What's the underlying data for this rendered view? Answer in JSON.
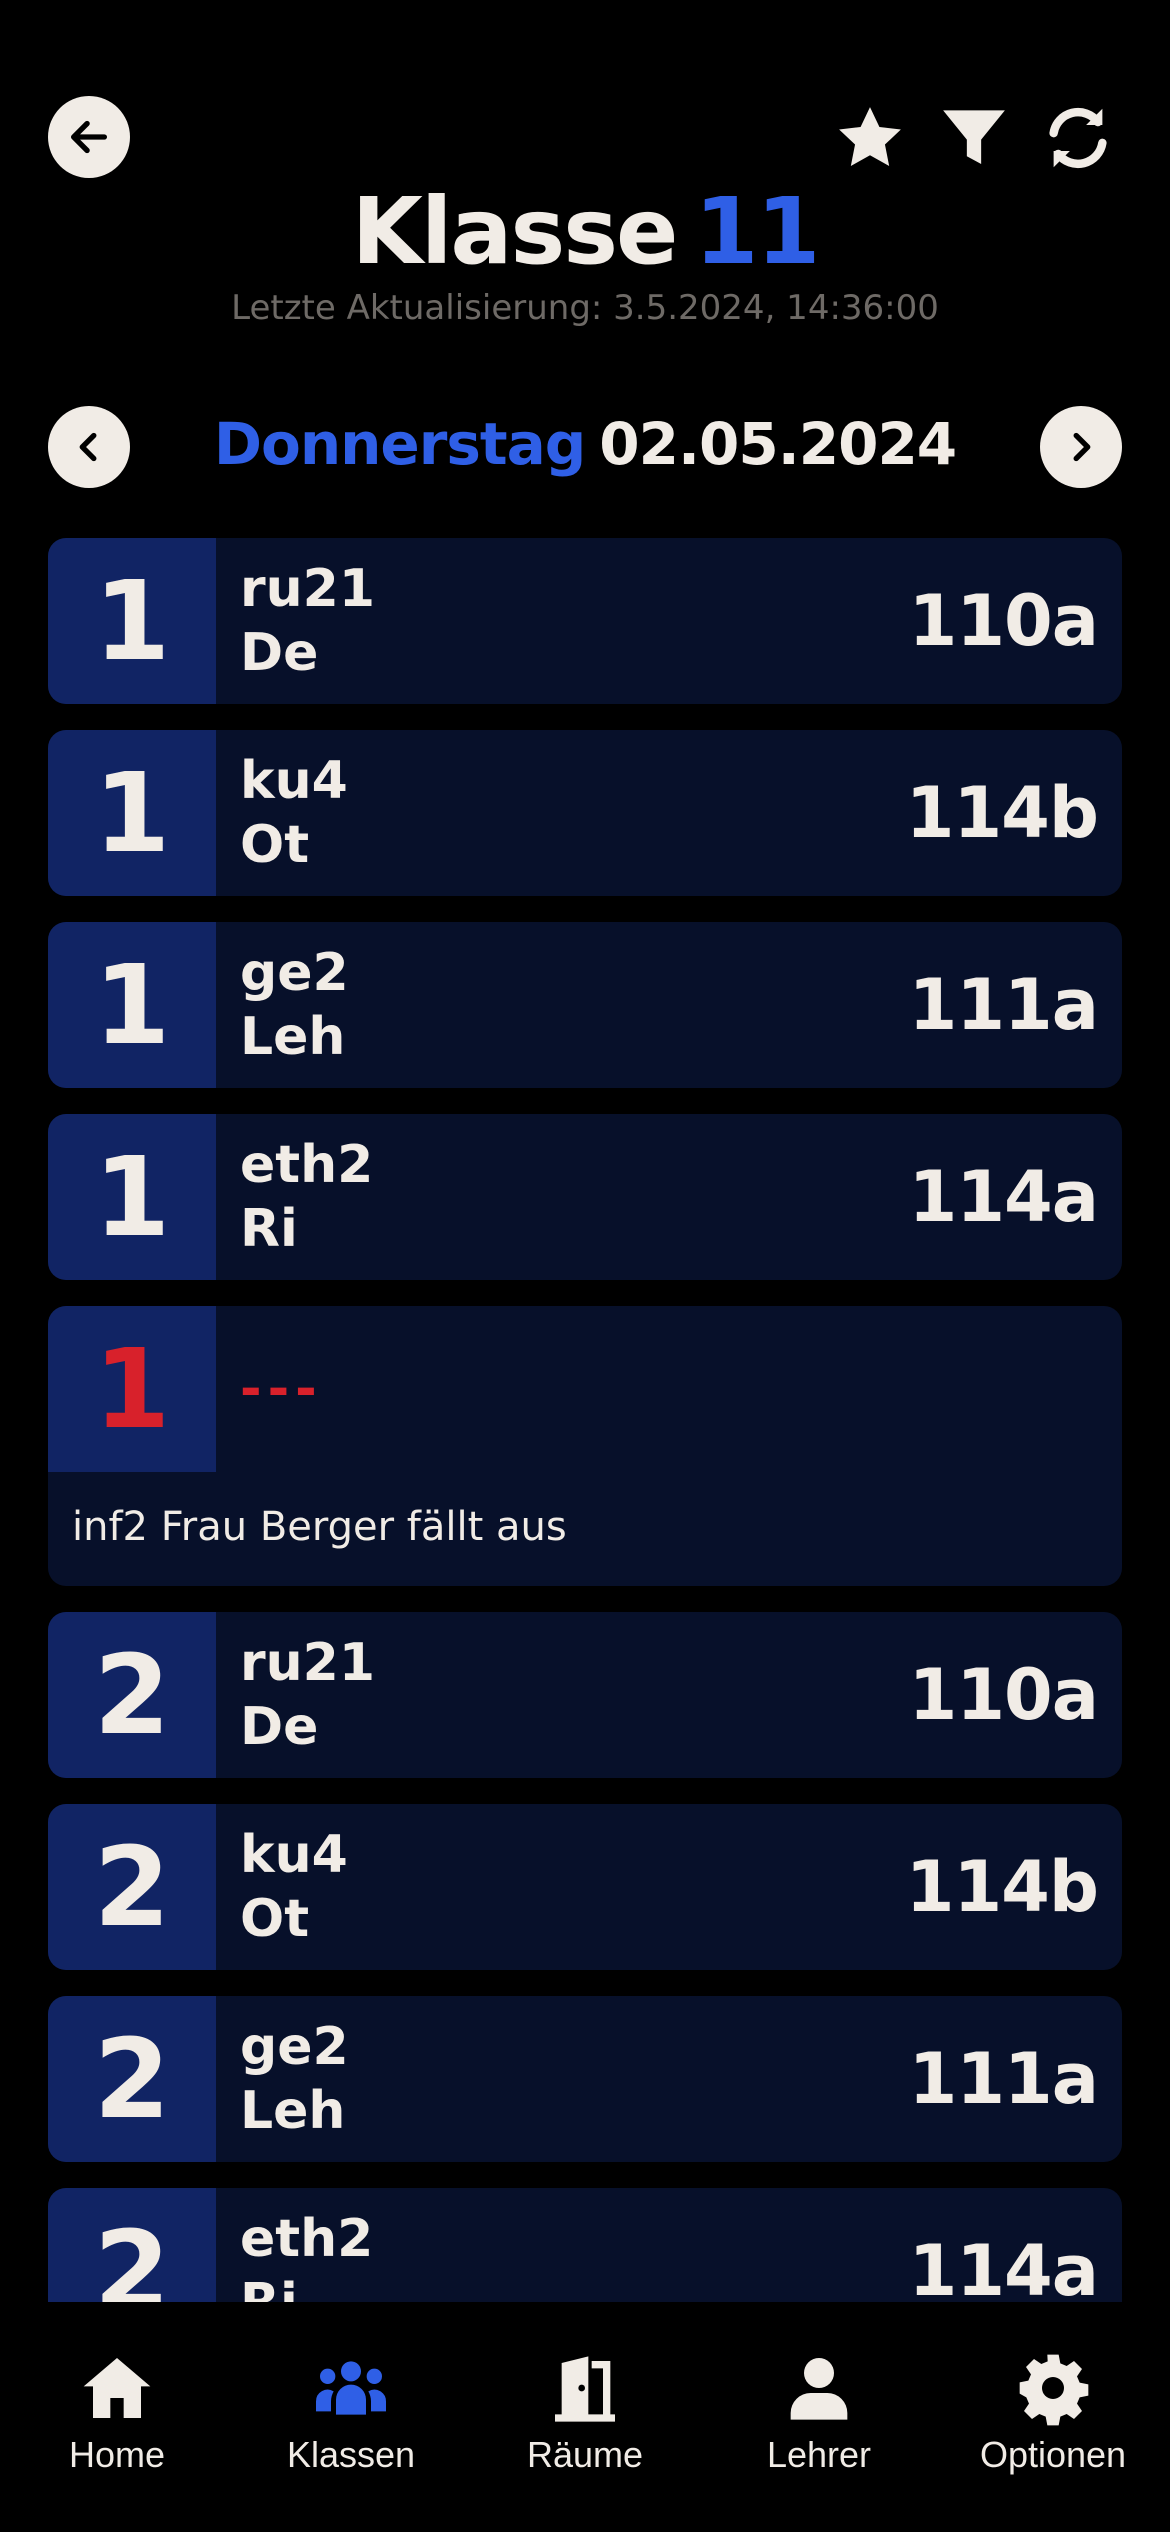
{
  "header": {
    "title": "Klasse",
    "class_number": "11",
    "last_update": "Letzte Aktualisierung: 3.5.2024, 14:36:00"
  },
  "date_nav": {
    "weekday": "Donnerstag",
    "date": "02.05.2024"
  },
  "entries": [
    {
      "period": "1",
      "subject": "ru21",
      "teacher": "De",
      "room": "110a"
    },
    {
      "period": "1",
      "subject": "ku4",
      "teacher": "Ot",
      "room": "114b"
    },
    {
      "period": "1",
      "subject": "ge2",
      "teacher": "Leh",
      "room": "111a"
    },
    {
      "period": "1",
      "subject": "eth2",
      "teacher": "Ri",
      "room": "114a"
    },
    {
      "period": "1",
      "placeholder": "---",
      "note": "inf2 Frau Berger fällt aus",
      "cancelled": true
    },
    {
      "period": "2",
      "subject": "ru21",
      "teacher": "De",
      "room": "110a"
    },
    {
      "period": "2",
      "subject": "ku4",
      "teacher": "Ot",
      "room": "114b"
    },
    {
      "period": "2",
      "subject": "ge2",
      "teacher": "Leh",
      "room": "111a"
    },
    {
      "period": "2",
      "subject": "eth2",
      "teacher": "Ri",
      "room": "114a"
    }
  ],
  "bottom_nav": {
    "items": [
      {
        "label": "Home",
        "icon": "home-icon"
      },
      {
        "label": "Klassen",
        "icon": "group-icon",
        "active": true
      },
      {
        "label": "Räume",
        "icon": "door-icon"
      },
      {
        "label": "Lehrer",
        "icon": "person-icon"
      },
      {
        "label": "Optionen",
        "icon": "gear-icon"
      }
    ]
  },
  "colors": {
    "accent": "#2f5fe6",
    "card": "#07102a",
    "period_cell": "#112464",
    "cancelled": "#d8212b",
    "text": "#f1ece6"
  }
}
